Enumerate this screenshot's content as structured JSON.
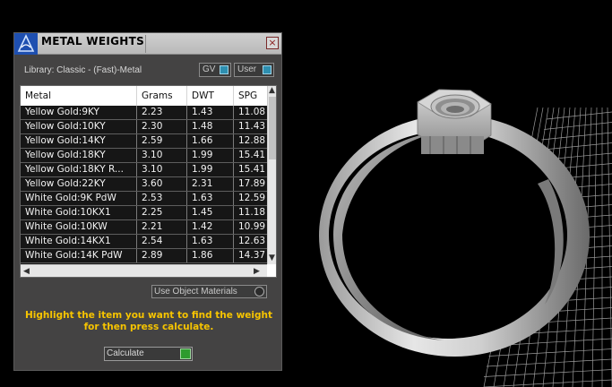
{
  "panel": {
    "title": "METAL WEIGHTS",
    "close_symbol": "×",
    "library_label": "Library: Classic - (Fast)-Metal",
    "toggles": [
      {
        "label": "GV",
        "icon": "toggle-icon"
      },
      {
        "label": "User",
        "icon": "toggle-icon"
      }
    ],
    "table": {
      "headers": [
        "Metal",
        "Grams",
        "DWT",
        "SPG"
      ],
      "rows": [
        [
          "Yellow Gold:9KY",
          "2.23",
          "1.43",
          "11.08"
        ],
        [
          "Yellow Gold:10KY",
          "2.30",
          "1.48",
          "11.43"
        ],
        [
          "Yellow Gold:14KY",
          "2.59",
          "1.66",
          "12.88"
        ],
        [
          "Yellow Gold:18KY",
          "3.10",
          "1.99",
          "15.41"
        ],
        [
          "Yellow Gold:18KY R...",
          "3.10",
          "1.99",
          "15.41"
        ],
        [
          "Yellow Gold:22KY",
          "3.60",
          "2.31",
          "17.89"
        ],
        [
          "White Gold:9K PdW",
          "2.53",
          "1.63",
          "12.59"
        ],
        [
          "White Gold:10KX1",
          "2.25",
          "1.45",
          "11.18"
        ],
        [
          "White Gold:10KW",
          "2.21",
          "1.42",
          "10.99"
        ],
        [
          "White Gold:14KX1",
          "2.54",
          "1.63",
          "12.63"
        ],
        [
          "White Gold:14K PdW",
          "2.89",
          "1.86",
          "14.37"
        ]
      ]
    },
    "use_object_materials_label": "Use Object Materials",
    "hint_text": "Highlight the item you want to find the weight for then press calculate.",
    "calculate_label": "Calculate"
  },
  "colors": {
    "panel_bg": "#444343",
    "hint": "#f6c400",
    "toggle_accent": "#2e8fb0",
    "calculate_accent": "#2e9b2e"
  },
  "scene": {
    "description_icons": [
      "ring-model",
      "hex-nut-model",
      "grid-plane"
    ]
  }
}
